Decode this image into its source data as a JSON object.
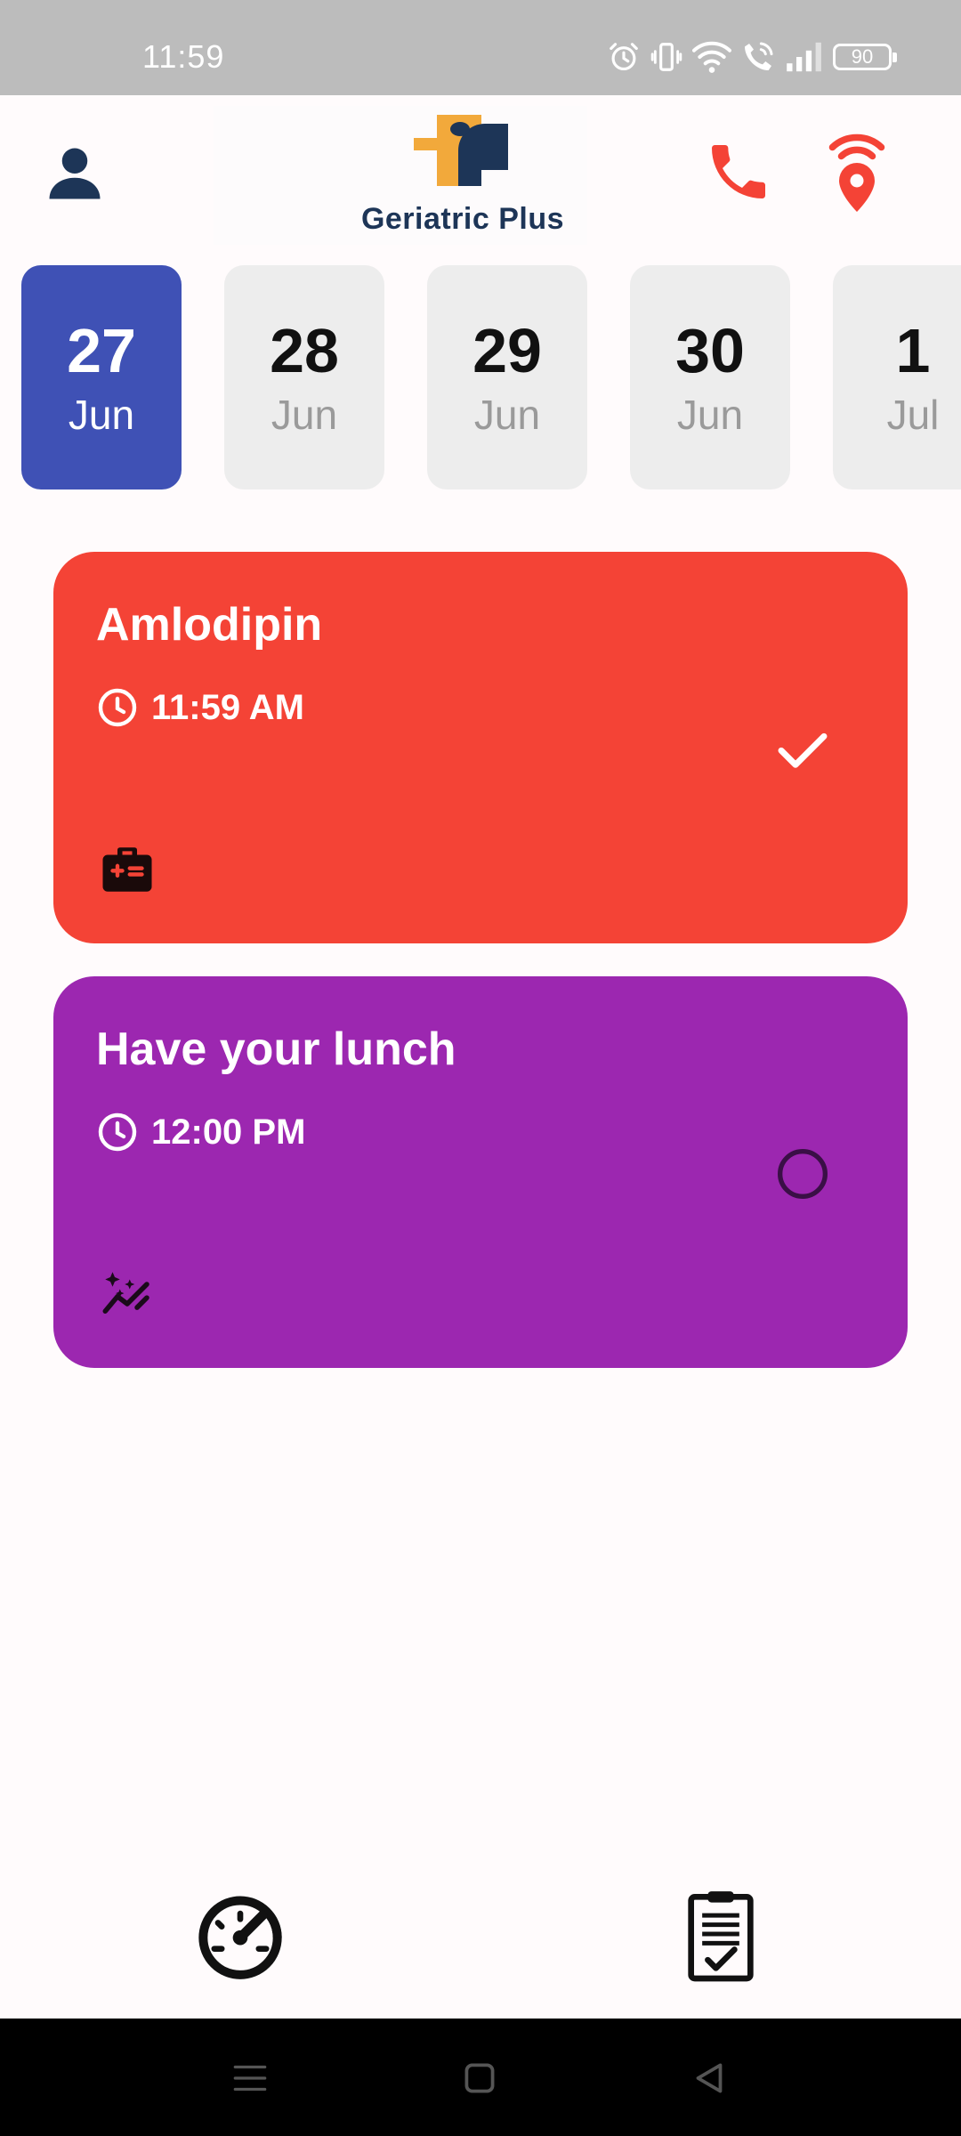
{
  "status_bar": {
    "time": "11:59",
    "battery": "90",
    "icons": [
      "alarm-icon",
      "vibrate-icon",
      "wifi-icon",
      "wifi-call-icon",
      "signal-icon",
      "battery-icon"
    ]
  },
  "header": {
    "brand": "Geriatric Plus",
    "icons": [
      "profile-icon",
      "phone-icon",
      "location-signal-icon"
    ],
    "colors": {
      "brand_orange": "#f2a93b",
      "brand_navy": "#1d3557",
      "action_red": "#f44336"
    }
  },
  "dates": [
    {
      "day": "27",
      "month": "Jun",
      "selected": true
    },
    {
      "day": "28",
      "month": "Jun",
      "selected": false
    },
    {
      "day": "29",
      "month": "Jun",
      "selected": false
    },
    {
      "day": "30",
      "month": "Jun",
      "selected": false
    },
    {
      "day": "1",
      "month": "Jul",
      "selected": false
    }
  ],
  "tasks": [
    {
      "title": "Amlodipin",
      "time": "11:59 AM",
      "color": "#f44336",
      "done": true,
      "category_icon": "medical-kit-icon",
      "status_icon": "checkmark-icon"
    },
    {
      "title": "Have your lunch",
      "time": "12:00 PM",
      "color": "#9c27b0",
      "done": false,
      "category_icon": "sparkle-chart-icon",
      "status_icon": "circle-outline-icon"
    }
  ],
  "bottom_nav": {
    "items": [
      "speedometer-icon",
      "clipboard-check-icon"
    ]
  },
  "system_nav": {
    "items": [
      "menu-icon",
      "home-icon",
      "back-icon"
    ]
  }
}
